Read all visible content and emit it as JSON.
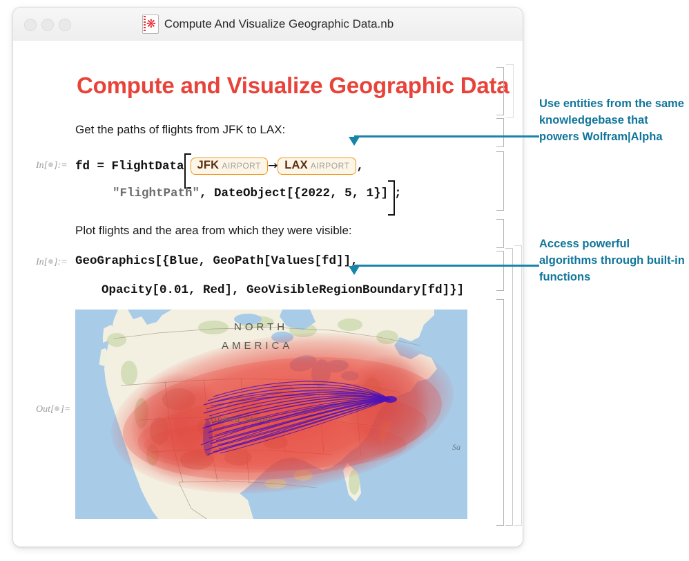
{
  "window": {
    "title": "Compute And Visualize Geographic Data.nb",
    "icon": "wolfram-notebook-icon",
    "traffic_lights": [
      "close",
      "minimize",
      "zoom"
    ]
  },
  "notebook": {
    "heading": "Compute and Visualize Geographic Data",
    "text_cells": [
      "Get the paths of flights from JFK to LAX:",
      "Plot flights and the area from which they were visible:"
    ],
    "in_label": "In[",
    "in_label_end": "]:=",
    "out_label": "Out[",
    "out_label_end": "]=",
    "input1": {
      "line1_prefix": "fd = FlightData",
      "entity_a": {
        "name": "JFK",
        "type": "AIRPORT"
      },
      "rule_arrow": "→",
      "entity_b": {
        "name": "LAX",
        "type": "AIRPORT"
      },
      "line1_suffix": ",",
      "line2_string": "\"FlightPath\"",
      "line2_rest": ", DateObject[{2022, 5, 1}]",
      "line2_tail": ";"
    },
    "input2": {
      "line1": "GeoGraphics[{Blue, GeoPath[Values[fd]],",
      "line2": "Opacity[0.01, Red], GeoVisibleRegionBoundary[fd]}]"
    },
    "output_map": {
      "labels": [
        "NORTH",
        "AMERICA",
        "United States",
        "Sa"
      ],
      "ocean_color": "#a8cbe8",
      "land_color": "#f3f0e2",
      "visible_region_color": "#e83c32",
      "flight_path_color": "#4b11b8"
    }
  },
  "annotations": [
    {
      "id": "annotation-entities",
      "text": "Use entities from the same knowledgebase that powers Wolfram|Alpha",
      "color": "#10759b"
    },
    {
      "id": "annotation-algorithms",
      "text": "Access powerful algorithms through built-in functions",
      "color": "#10759b"
    }
  ]
}
